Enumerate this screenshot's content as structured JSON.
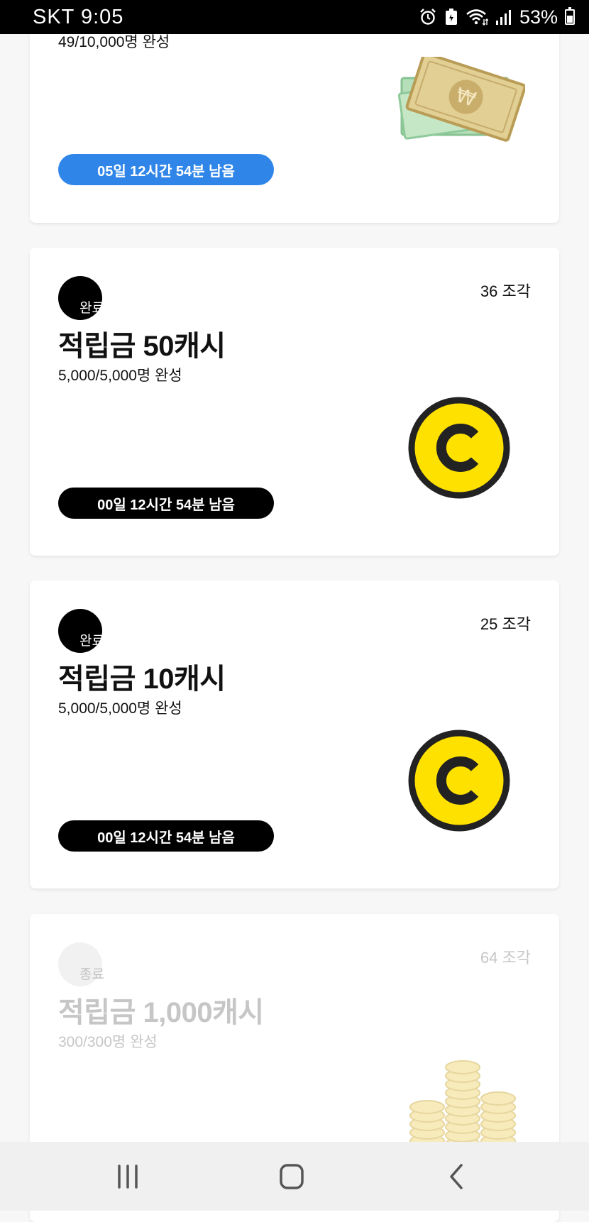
{
  "status_bar": {
    "carrier": "SKT",
    "time": "9:05",
    "battery": "53%"
  },
  "cards": [
    {
      "subtitle": "49/10,000명 완성",
      "timer": "05일 12시간 54분 남음",
      "image": "cash-bills-icon"
    },
    {
      "pieces": "36 조각",
      "badge": "완료",
      "title": "적립금 50캐시",
      "subtitle": "5,000/5,000명 완성",
      "timer": "00일 12시간 54분 남음",
      "image": "coin-c-icon"
    },
    {
      "pieces": "25 조각",
      "badge": "완료",
      "title": "적립금 10캐시",
      "subtitle": "5,000/5,000명 완성",
      "timer": "00일 12시간 54분 남음",
      "image": "coin-c-icon"
    },
    {
      "pieces": "64 조각",
      "badge": "종료",
      "title": "적립금 1,000캐시",
      "subtitle": "300/300명 완성",
      "image": "gold-coin-stack-icon"
    }
  ],
  "nav": {
    "recents": "recent-apps-icon",
    "home": "home-icon",
    "back": "back-icon"
  },
  "colors": {
    "timer_active": "#2f86e8",
    "timer_done": "#000000",
    "coin_yellow": "#ffe100"
  }
}
